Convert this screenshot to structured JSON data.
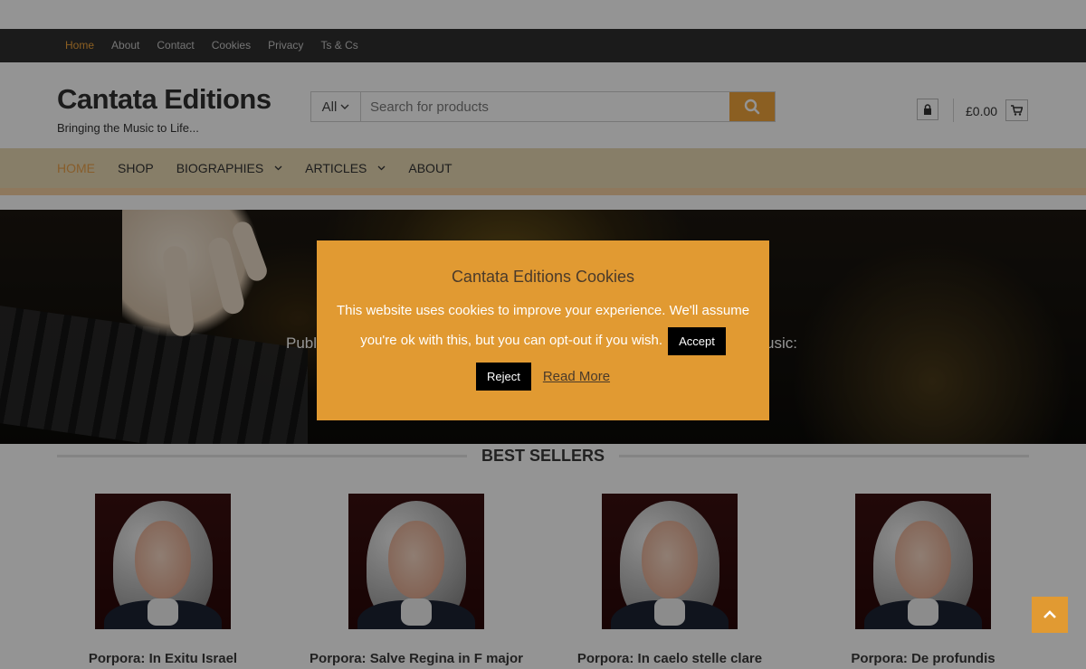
{
  "topbar": {
    "links": [
      "Home",
      "About",
      "Contact",
      "Cookies",
      "Privacy",
      "Ts & Cs"
    ]
  },
  "header": {
    "site_title": "Cantata Editions",
    "tagline": "Bringing the Music to Life...",
    "search": {
      "category": "All",
      "placeholder": "Search for products"
    },
    "cart_total": "£0.00"
  },
  "nav": {
    "items": [
      "Home",
      "Shop",
      "Biographies",
      "Articles",
      "About"
    ]
  },
  "hero": {
    "text_left": "Publ",
    "text_right": "usic:"
  },
  "best_sellers": {
    "heading": "BEST SELLERS",
    "products": [
      "Porpora: In Exitu Israel",
      "Porpora: Salve Regina in F major",
      "Porpora: In caelo stelle clare",
      "Porpora: De profundis"
    ]
  },
  "cookie_dialog": {
    "title": "Cantata Editions Cookies",
    "message": "This website uses cookies to improve your experience. We'll assume you're ok with this, but you can opt-out if you wish.",
    "accept_label": "Accept",
    "reject_label": "Reject",
    "read_more_label": "Read More"
  },
  "colors": {
    "accent": "#e19a32",
    "topbar_bg": "#2f2f2f",
    "nav_bg": "#e8d9b4"
  },
  "icons": {
    "search": "search-icon",
    "account": "lock-icon",
    "cart": "cart-icon",
    "back_to_top": "chevron-up-icon"
  }
}
